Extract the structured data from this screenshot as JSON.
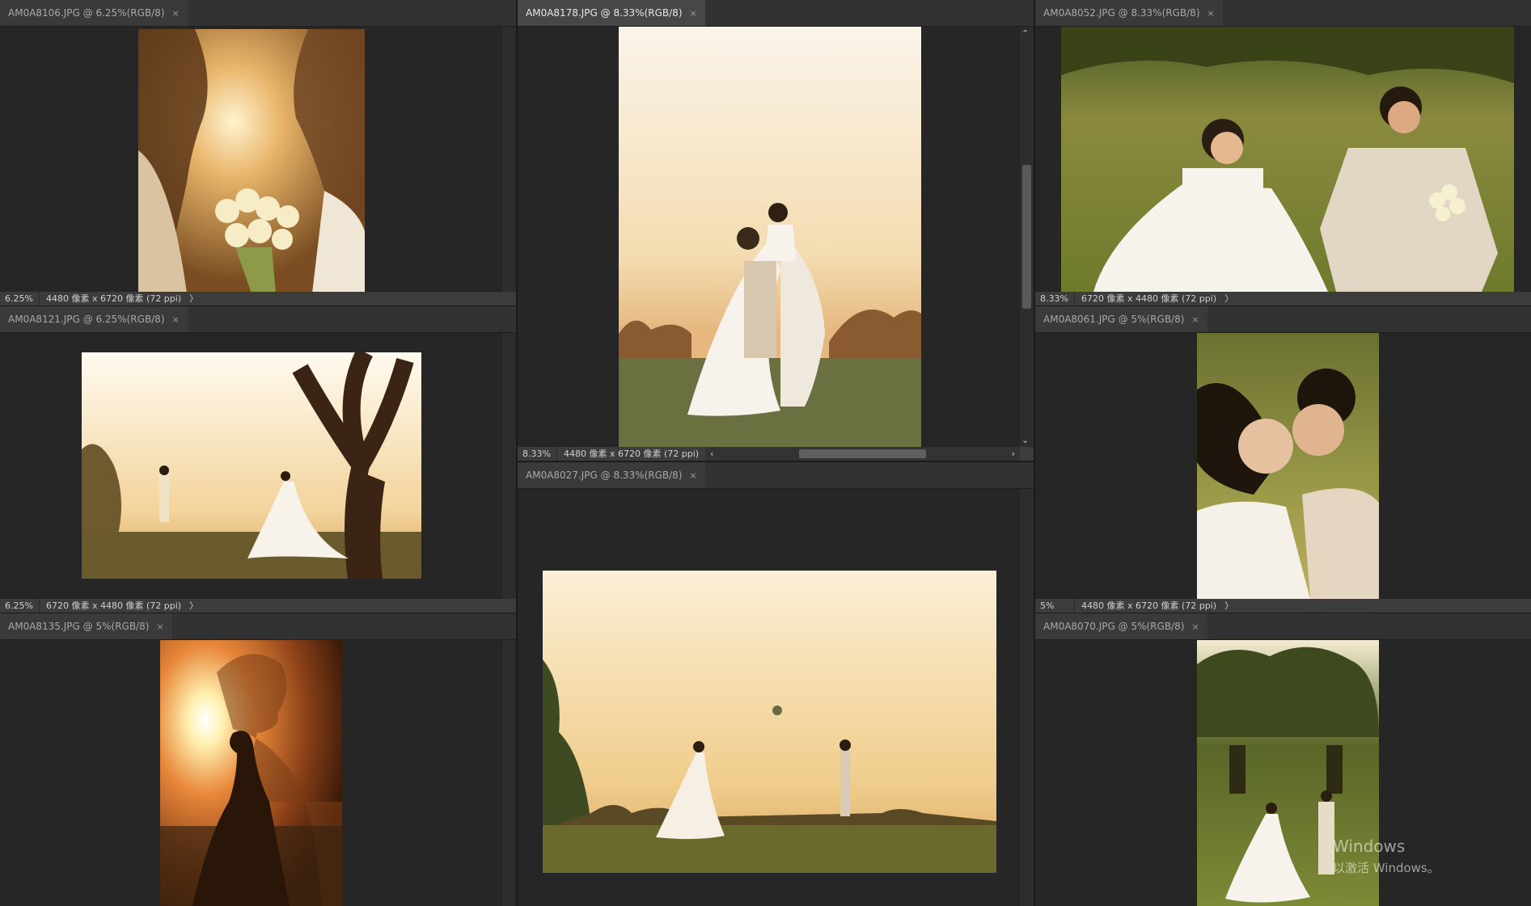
{
  "panels": [
    {
      "tab": "AM0A8106.JPG @ 6.25%(RGB/8)",
      "zoom": "6.25%",
      "info": "4480 像素 x 6720 像素 (72 ppi)",
      "arrow": "〉"
    },
    {
      "tab": "AM0A8178.JPG @ 8.33%(RGB/8)",
      "zoom": "8.33%",
      "info": "4480 像素 x 6720 像素 (72 ppi)",
      "arrow": "〉"
    },
    {
      "tab": "AM0A8052.JPG @ 8.33%(RGB/8)",
      "zoom": "8.33%",
      "info": "6720 像素 x 4480 像素 (72 ppi)",
      "arrow": "〉"
    },
    {
      "tab": "AM0A8121.JPG @ 6.25%(RGB/8)",
      "zoom": "6.25%",
      "info": "6720 像素 x 4480 像素 (72 ppi)",
      "arrow": "〉"
    },
    {
      "tab": "AM0A8061.JPG @ 5%(RGB/8)",
      "zoom": "5%",
      "info": "4480 像素 x 6720 像素 (72 ppi)",
      "arrow": "〉"
    },
    {
      "tab": "AM0A8027.JPG @ 8.33%(RGB/8)"
    },
    {
      "tab": "AM0A8135.JPG @ 5%(RGB/8)"
    },
    {
      "tab": "AM0A8070.JPG @ 5%(RGB/8)"
    }
  ],
  "close_glyph": "×",
  "hscroll_left": "‹",
  "hscroll_right": "›",
  "vscroll_up": "⌃",
  "vscroll_down": "⌄",
  "watermark": {
    "line1": "Windows",
    "line2": "以激活 Windows。"
  }
}
